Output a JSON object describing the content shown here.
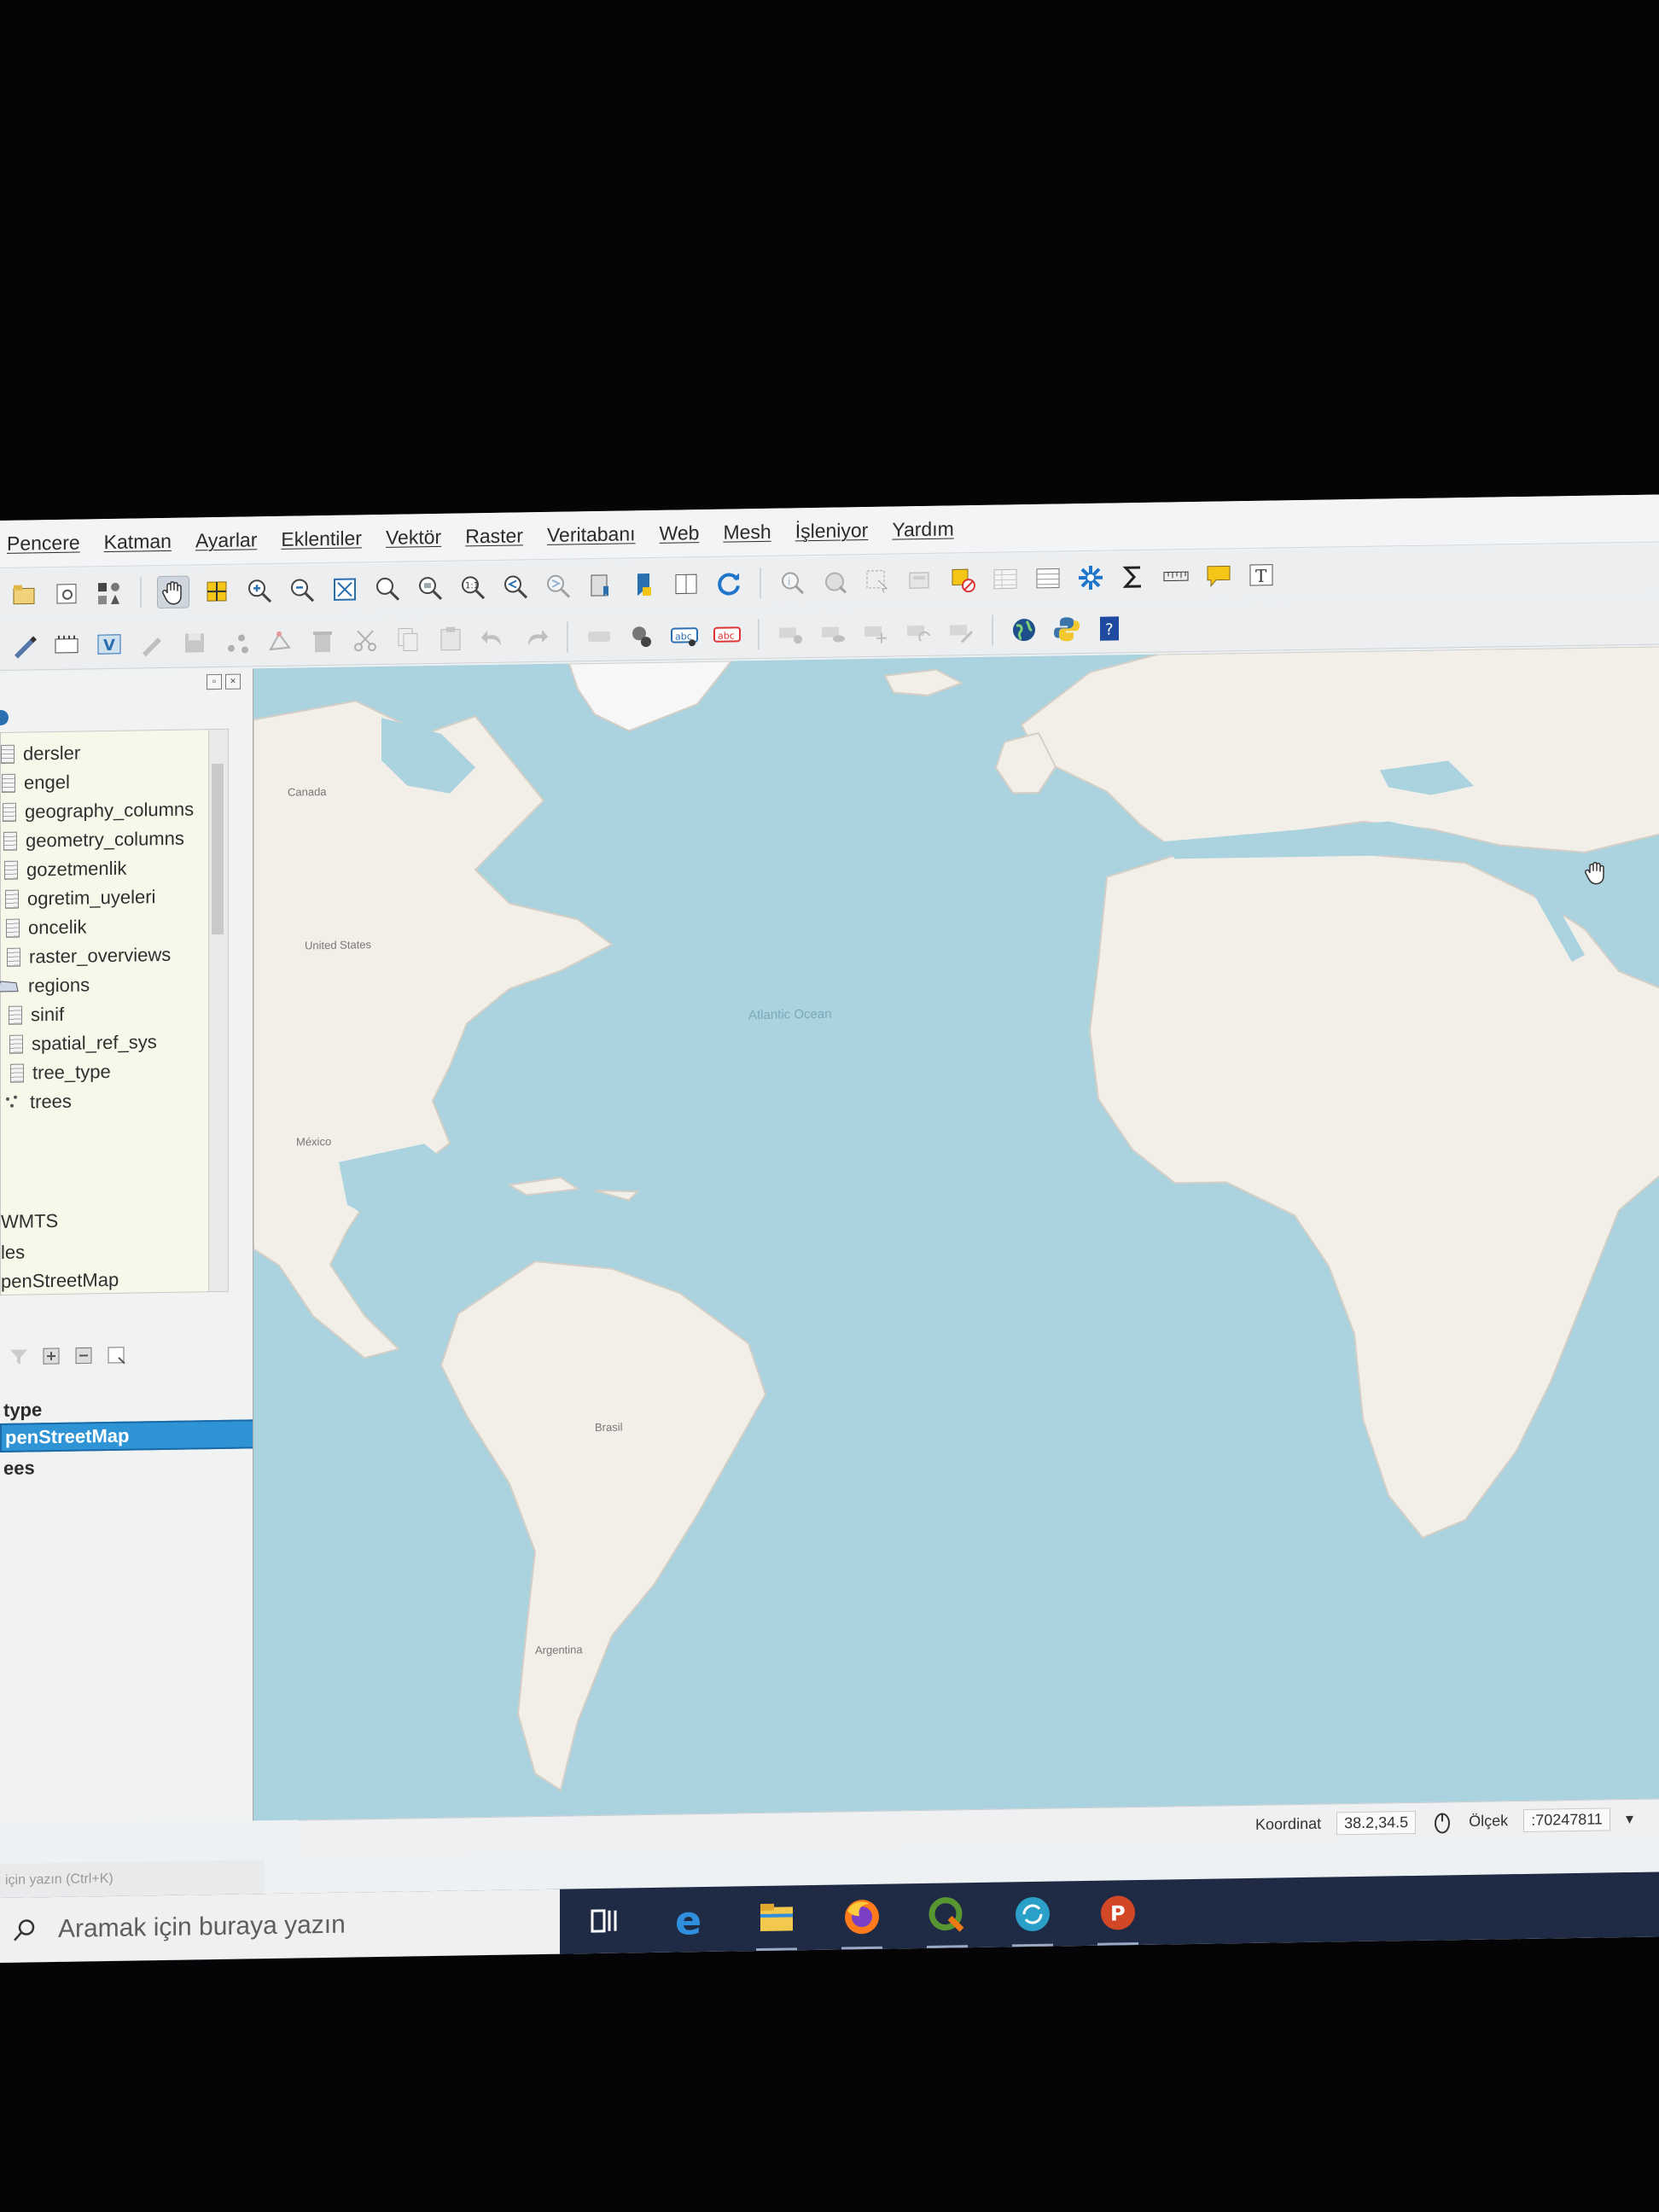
{
  "menu": [
    "Pencere",
    "Katman",
    "Ayarlar",
    "Eklentiler",
    "Vektör",
    "Raster",
    "Veritabanı",
    "Web",
    "Mesh",
    "İşleniyor",
    "Yardım"
  ],
  "browser": {
    "items": [
      "dersler",
      "engel",
      "geography_columns",
      "geometry_columns",
      "gozetmenlik",
      "ogretim_uyeleri",
      "oncelik",
      "raster_overviews",
      "regions",
      "sinif",
      "spatial_ref_sys",
      "tree_type",
      "trees"
    ],
    "extra_items": [
      "WMTS",
      "les",
      "penStreetMap"
    ]
  },
  "layers": {
    "rows": [
      "type",
      "penStreetMap",
      "ees"
    ],
    "selected": "penStreetMap"
  },
  "map": {
    "ocean_color": "#aad3df",
    "land_color": "#f2efe9",
    "ice_color": "#f7f7f7",
    "labels": [
      "Atlantic Ocean",
      "United States",
      "Brasil",
      "México",
      "Canada",
      "Argentina"
    ]
  },
  "status": {
    "coord_label": "Koordinat",
    "coord_value": "38.2,34.5",
    "scale_label": "Ölçek",
    "scale_value": ":70247811"
  },
  "locator": {
    "placeholder": "için yazın (Ctrl+K)"
  },
  "taskbar": {
    "search_placeholder": "Aramak için buraya yazın",
    "apps": [
      "task-view",
      "edge",
      "file-explorer",
      "firefox",
      "qgis",
      "sync",
      "powerpoint"
    ]
  },
  "colors": {
    "accent": "#2e94d6",
    "taskbar": "#1f2a44",
    "ocean": "#aad3df"
  }
}
